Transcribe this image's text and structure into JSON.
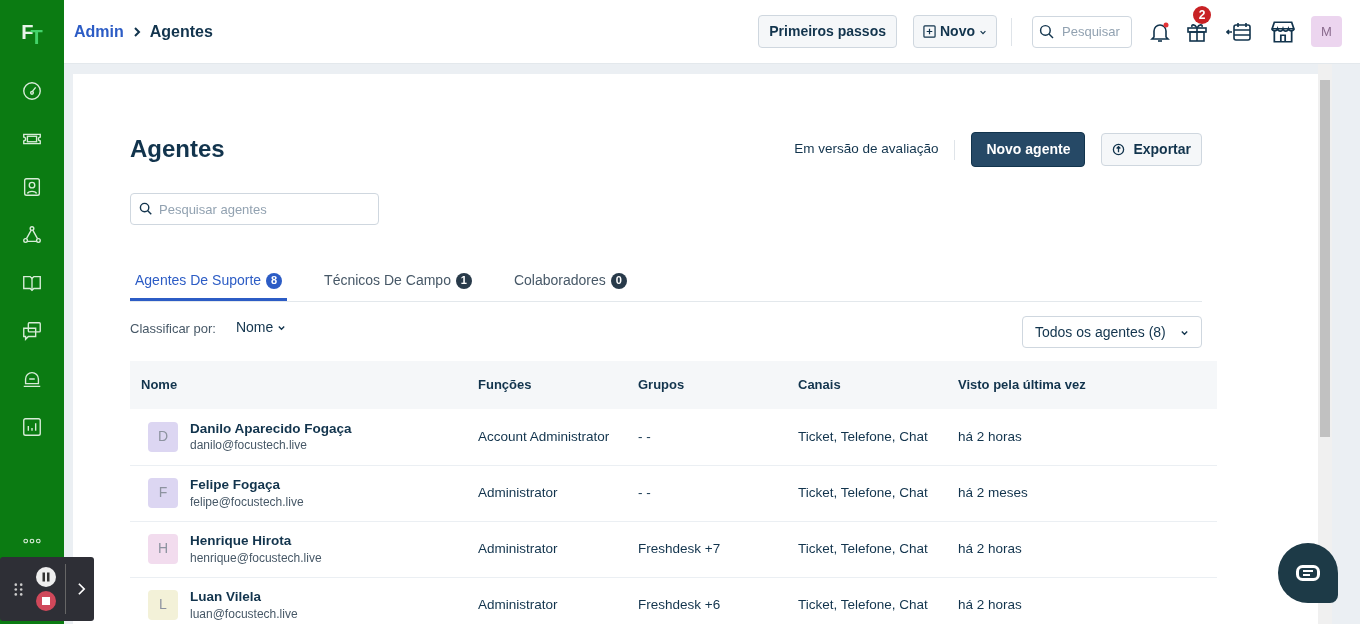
{
  "logo": "FT",
  "breadcrumb": [
    {
      "label": "Admin",
      "kind": "link"
    },
    {
      "label": "Agentes",
      "kind": "current"
    }
  ],
  "header": {
    "getting_started": "Primeiros passos",
    "new_button": "Novo",
    "search": {
      "placeholder": "Pesquisar"
    },
    "gift_badge": "2",
    "avatar": "M"
  },
  "page": {
    "title": "Agentes",
    "trial_label": "Em versão de avaliação",
    "new_agent_button": "Novo agente",
    "export_button": "Exportar",
    "search": {
      "placeholder": "Pesquisar agentes"
    }
  },
  "tabs": [
    {
      "label": "Agentes De Suporte",
      "count": "8",
      "selected": true
    },
    {
      "label": "Técnicos De Campo",
      "count": "1",
      "selected": false
    },
    {
      "label": "Colaboradores",
      "count": "0",
      "selected": false
    }
  ],
  "sort": {
    "label": "Classificar por:",
    "value": "Nome"
  },
  "filter": "Todos os agentes (8)",
  "table": {
    "columns": [
      "Nome",
      "Funções",
      "Grupos",
      "Canais",
      "Visto pela última vez"
    ],
    "rows": [
      {
        "initial": "D",
        "color": "#dcd6f2",
        "name": "Danilo Aparecido Fogaça",
        "email": "danilo@focustech.live",
        "role": "Account Administrator",
        "groups": "- -",
        "channels": "Ticket, Telefone, Chat",
        "last_seen": "há 2 horas"
      },
      {
        "initial": "F",
        "color": "#dcd6f2",
        "name": "Felipe Fogaça",
        "email": "felipe@focustech.live",
        "role": "Administrator",
        "groups": "- -",
        "channels": "Ticket, Telefone, Chat",
        "last_seen": "há 2 meses"
      },
      {
        "initial": "H",
        "color": "#f2dcee",
        "name": "Henrique Hirota",
        "email": "henrique@focustech.live",
        "role": "Administrator",
        "groups": "Freshdesk +7",
        "channels": "Ticket, Telefone, Chat",
        "last_seen": "há 2 horas"
      },
      {
        "initial": "L",
        "color": "#f3f1d8",
        "name": "Luan Vilela",
        "email": "luan@focustech.live",
        "role": "Administrator",
        "groups": "Freshdesk +6",
        "channels": "Ticket, Telefone, Chat",
        "last_seen": "há 2 horas"
      }
    ]
  }
}
